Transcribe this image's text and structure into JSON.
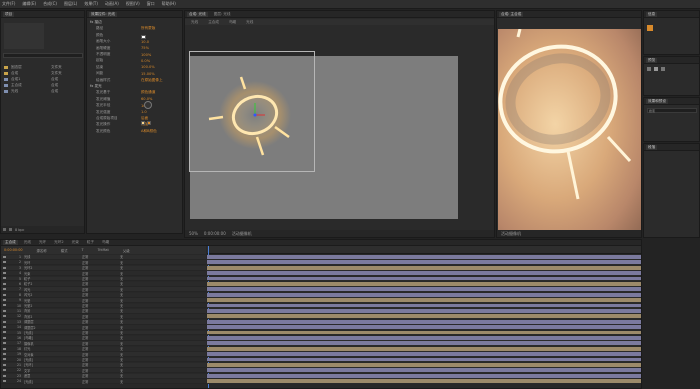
{
  "menu": [
    "文件(F)",
    "编辑(E)",
    "合成(C)",
    "图层(L)",
    "效果(T)",
    "动画(A)",
    "视图(V)",
    "窗口",
    "帮助(H)"
  ],
  "project_panel": {
    "tab": "项目",
    "items": [
      {
        "name": "固态层",
        "type": "文件夹"
      },
      {
        "name": "合成",
        "type": "文件夹"
      },
      {
        "name": "合成1",
        "type": "合成"
      },
      {
        "name": "主合成",
        "type": "合成"
      },
      {
        "name": "光线",
        "type": "合成"
      }
    ],
    "footer": "8 bpc"
  },
  "effect_controls": {
    "tab": "效果控件: 光线",
    "rows": [
      {
        "label": "fx 描边",
        "value": ""
      },
      {
        "label": "路径",
        "value": "所有蒙版"
      },
      {
        "label": "颜色",
        "value": ""
      },
      {
        "label": "画笔大小",
        "value": "10.0"
      },
      {
        "label": "画笔硬度",
        "value": "75%"
      },
      {
        "label": "不透明度",
        "value": "100%"
      },
      {
        "label": "起始",
        "value": "0.0%"
      },
      {
        "label": "结束",
        "value": "100.0%"
      },
      {
        "label": "间距",
        "value": "15.00%"
      },
      {
        "label": "绘画样式",
        "value": "在原始图像上"
      },
      {
        "label": "fx 发光",
        "value": ""
      },
      {
        "label": "发光基于",
        "value": "颜色通道"
      },
      {
        "label": "发光阈值",
        "value": "60.0%"
      },
      {
        "label": "发光半径",
        "value": "10.0"
      },
      {
        "label": "发光强度",
        "value": "1.0"
      },
      {
        "label": "合成原始项目",
        "value": "后面"
      },
      {
        "label": "发光操作",
        "value": "相加"
      },
      {
        "label": "发光颜色",
        "value": "A和B颜色"
      }
    ]
  },
  "comp_panel": {
    "tabs": [
      "合成: 光线",
      "图层: 光线"
    ],
    "subtabs": [
      "光线",
      "主合成",
      "鸟瞰",
      "光线"
    ],
    "zoom": "50%",
    "time": "0:00:00:00",
    "footer_label": "活动摄像机"
  },
  "preview_panel": {
    "tab": "合成: 主合成",
    "footer_label": "活动摄像机"
  },
  "right_panels": {
    "info_tab": "信息",
    "preview_tab": "预览",
    "effects_tab": "效果和预设",
    "paragraph_tab": "段落",
    "search_placeholder": "搜索"
  },
  "timeline": {
    "tabs": [
      "主合成",
      "光线",
      "光环",
      "光环2",
      "光束",
      "粒子",
      "鸟瞰"
    ],
    "time": "0:00:00:00",
    "columns": [
      "源名称",
      "模式",
      "T",
      "TrkMat",
      "父级"
    ],
    "layers": [
      {
        "num": "1",
        "name": "光线",
        "mode": "正常",
        "parent": "无"
      },
      {
        "num": "2",
        "name": "光环",
        "mode": "正常",
        "parent": "无"
      },
      {
        "num": "3",
        "name": "光环2",
        "mode": "正常",
        "parent": "无"
      },
      {
        "num": "4",
        "name": "光束",
        "mode": "正常",
        "parent": "无"
      },
      {
        "num": "5",
        "name": "粒子",
        "mode": "正常",
        "parent": "无"
      },
      {
        "num": "6",
        "name": "粒子2",
        "mode": "正常",
        "parent": "无"
      },
      {
        "num": "7",
        "name": "闪光",
        "mode": "正常",
        "parent": "无"
      },
      {
        "num": "8",
        "name": "闪光2",
        "mode": "正常",
        "parent": "无"
      },
      {
        "num": "9",
        "name": "光晕",
        "mode": "正常",
        "parent": "无"
      },
      {
        "num": "10",
        "name": "光晕2",
        "mode": "正常",
        "parent": "无"
      },
      {
        "num": "11",
        "name": "背景",
        "mode": "正常",
        "parent": "无"
      },
      {
        "num": "12",
        "name": "背景2",
        "mode": "正常",
        "parent": "无"
      },
      {
        "num": "13",
        "name": "调整层",
        "mode": "正常",
        "parent": "无"
      },
      {
        "num": "14",
        "name": "调整层2",
        "mode": "正常",
        "parent": "无"
      },
      {
        "num": "15",
        "name": "[光线]",
        "mode": "正常",
        "parent": "无"
      },
      {
        "num": "16",
        "name": "[鸟瞰]",
        "mode": "正常",
        "parent": "无"
      },
      {
        "num": "17",
        "name": "摄像机",
        "mode": "正常",
        "parent": "无"
      },
      {
        "num": "18",
        "name": "灯光",
        "mode": "正常",
        "parent": "无"
      },
      {
        "num": "19",
        "name": "空对象",
        "mode": "正常",
        "parent": "无"
      },
      {
        "num": "20",
        "name": "[光线]",
        "mode": "正常",
        "parent": "无"
      },
      {
        "num": "21",
        "name": "[光环]",
        "mode": "正常",
        "parent": "无"
      },
      {
        "num": "22",
        "name": "文字",
        "mode": "正常",
        "parent": "无"
      },
      {
        "num": "23",
        "name": "遮罩",
        "mode": "正常",
        "parent": "无"
      },
      {
        "num": "24",
        "name": "[光线]",
        "mode": "正常",
        "parent": "无"
      }
    ],
    "bar_colors": [
      "#7b7a9e",
      "#9c8a6a"
    ]
  },
  "colors": {
    "accent": "#d98a2b",
    "selection_blue": "#2d6fb3"
  }
}
